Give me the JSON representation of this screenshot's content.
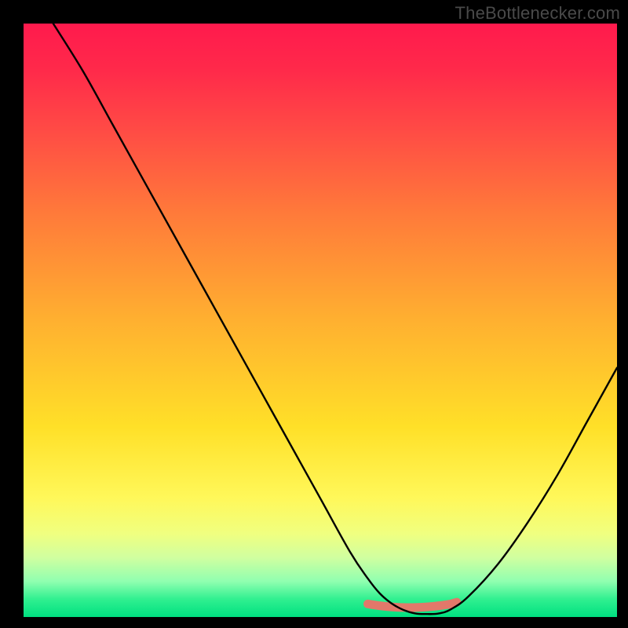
{
  "watermark": "TheBottlenecker.com",
  "chart_data": {
    "type": "line",
    "title": "",
    "xlabel": "",
    "ylabel": "",
    "xlim": [
      0,
      100
    ],
    "ylim": [
      0,
      100
    ],
    "series": [
      {
        "name": "curve",
        "x": [
          5,
          10,
          15,
          20,
          25,
          30,
          35,
          40,
          45,
          50,
          55,
          58,
          60,
          62,
          64,
          66,
          68,
          70,
          72,
          75,
          80,
          85,
          90,
          95,
          100
        ],
        "values": [
          100,
          92,
          83,
          74,
          65,
          56,
          47,
          38,
          29,
          20,
          11,
          6.5,
          4,
          2.3,
          1.2,
          0.6,
          0.5,
          0.6,
          1.3,
          3.5,
          9,
          16,
          24,
          33,
          42
        ]
      },
      {
        "name": "fit-segment",
        "x": [
          58,
          60,
          62,
          64,
          66,
          68,
          70,
          72,
          73
        ],
        "values": [
          2.2,
          1.9,
          1.7,
          1.6,
          1.6,
          1.7,
          1.9,
          2.2,
          2.5
        ]
      }
    ],
    "gradient_stops": [
      {
        "pos": 0,
        "color": "#ff1a4d"
      },
      {
        "pos": 8,
        "color": "#ff2a4a"
      },
      {
        "pos": 18,
        "color": "#ff4b45"
      },
      {
        "pos": 32,
        "color": "#ff7a3a"
      },
      {
        "pos": 50,
        "color": "#ffb030"
      },
      {
        "pos": 68,
        "color": "#ffe028"
      },
      {
        "pos": 80,
        "color": "#fff85a"
      },
      {
        "pos": 86,
        "color": "#f0ff80"
      },
      {
        "pos": 90,
        "color": "#d0ffa0"
      },
      {
        "pos": 94,
        "color": "#90ffb0"
      },
      {
        "pos": 97,
        "color": "#30f090"
      },
      {
        "pos": 100,
        "color": "#00e080"
      }
    ],
    "fit_color": "#e2786a"
  }
}
